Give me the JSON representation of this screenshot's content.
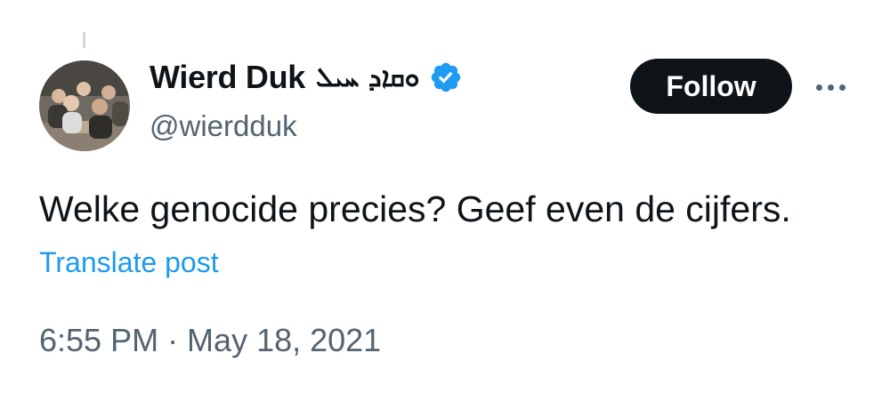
{
  "author": {
    "display_name": "Wierd Duk",
    "name_suffix": "ܘܩܐܕ ܚܝܠ",
    "handle": "@wierdduk",
    "verified": true,
    "verified_color": "#1d9bf0",
    "avatar_icon": "group-photo"
  },
  "actions": {
    "follow_label": "Follow",
    "more_icon": "ellipsis-horizontal-icon"
  },
  "tweet": {
    "text": "Welke genocide precies? Geef even de cijfers.",
    "translate_label": "Translate post",
    "timestamp": "6:55 PM · May 18, 2021"
  },
  "colors": {
    "text": "#0f1419",
    "secondary": "#536471",
    "accent": "#1d9bf0",
    "follow_bg": "#0f1419"
  }
}
